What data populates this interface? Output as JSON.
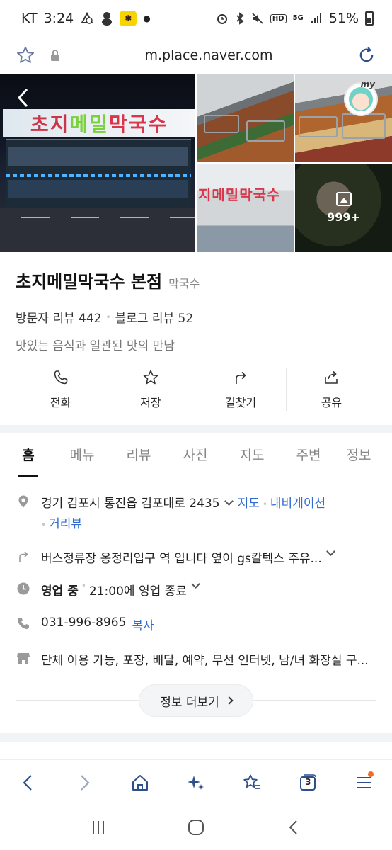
{
  "status_bar": {
    "carrier": "KT",
    "time": "3:24",
    "battery": "51%",
    "network": "5G",
    "hd_label": "HD"
  },
  "browser": {
    "url": "m.place.naver.com",
    "tab_count": "3"
  },
  "photos": {
    "more_count": "999+",
    "avatar_label": "my",
    "sign_text": [
      "초지",
      "메밀",
      "막국수"
    ],
    "sign_small": "지메밀막국수"
  },
  "place": {
    "name": "초지메밀막국수 본점",
    "category": "막국수",
    "visitor_reviews": "방문자 리뷰 442",
    "blog_reviews": "블로그 리뷰 52",
    "tagline": "맛있는 음식과 일관된 맛의 만남"
  },
  "actions": [
    {
      "label": "전화",
      "icon": "phone-icon"
    },
    {
      "label": "저장",
      "icon": "star-icon"
    },
    {
      "label": "길찾기",
      "icon": "directions-icon"
    },
    {
      "label": "공유",
      "icon": "share-icon"
    }
  ],
  "tabs": [
    "홈",
    "메뉴",
    "리뷰",
    "사진",
    "지도",
    "주변",
    "정보"
  ],
  "info": {
    "address": "경기 김포시 통진읍 김포대로 2435",
    "map_link": "지도",
    "navigation_link": "내비게이션",
    "distance_link": "거리뷰",
    "directions_text": "버스정류장 옹정리입구 역 입니다 옆이 gs칼텍스 주유...",
    "open_status": "영업 중",
    "hours": "21:00에 영업 종료",
    "phone": "031-996-8965",
    "copy_link": "복사",
    "amenities": "단체 이용 가능, 포장, 배달, 예약, 무선 인터넷, 남/녀 화장실 구...",
    "more_info_label": "정보 더보기"
  }
}
